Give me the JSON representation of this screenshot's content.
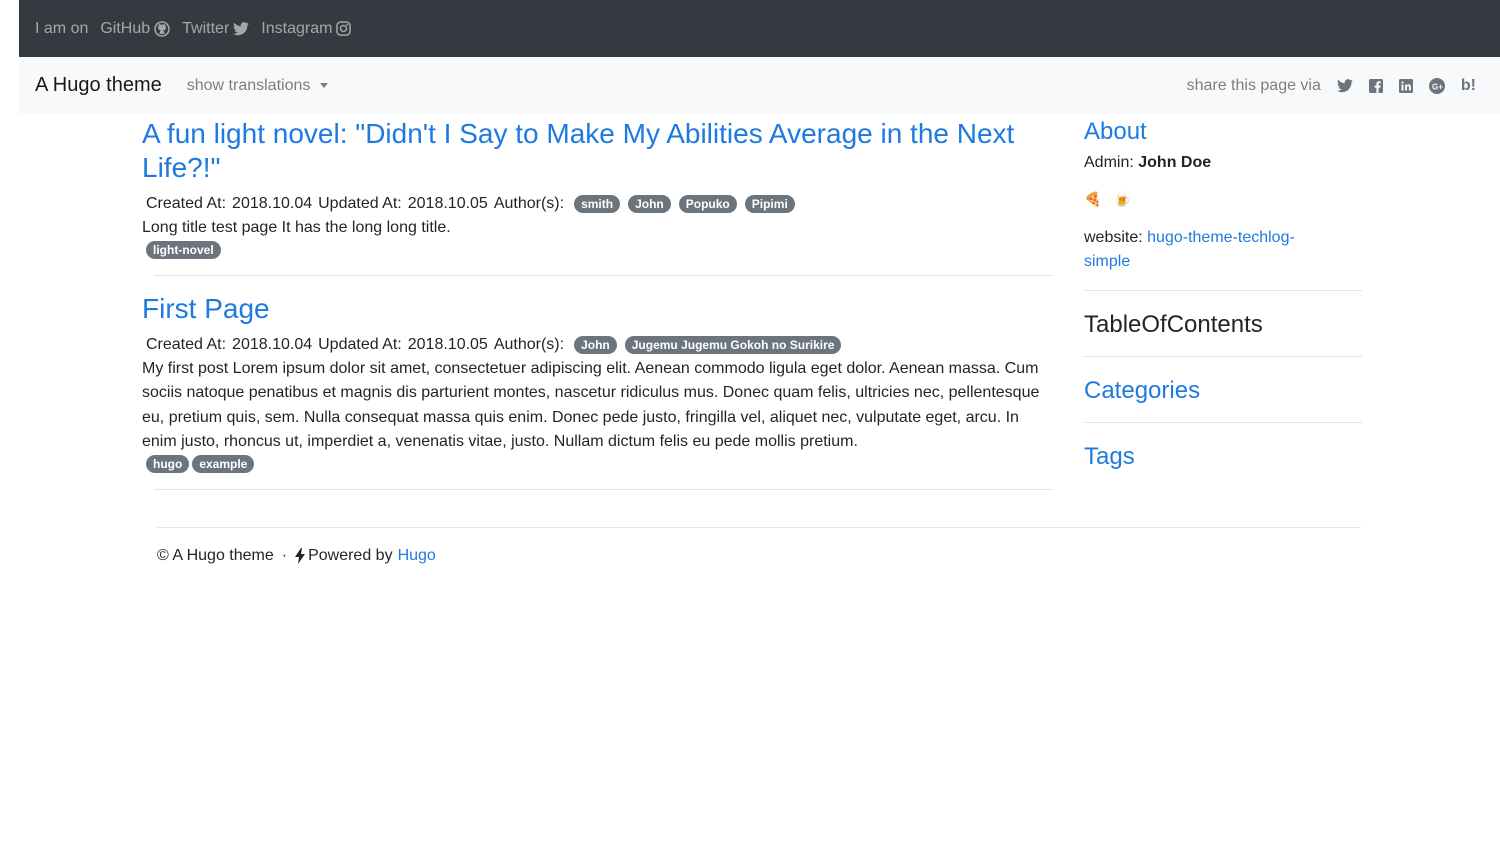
{
  "topbar": {
    "prefix": "I am on",
    "links": [
      {
        "label": "GitHub",
        "icon": "github-icon"
      },
      {
        "label": "Twitter",
        "icon": "twitter-icon"
      },
      {
        "label": "Instagram",
        "icon": "instagram-icon"
      }
    ]
  },
  "navbar": {
    "brand": "A Hugo theme",
    "translations": "show translations",
    "share_label": "share this page via",
    "share_icons": [
      "twitter-icon",
      "facebook-icon",
      "linkedin-icon",
      "google-plus-icon",
      "hatena-icon"
    ],
    "hatena_label": "b!"
  },
  "posts": [
    {
      "title": "A fun light novel: \"Didn't I Say to Make My Abilities Average in the Next Life?!\"",
      "created_label": "Created At:",
      "created": "2018.10.04",
      "updated_label": "Updated At:",
      "updated": "2018.10.05",
      "authors_label": "Author(s):",
      "authors": [
        "smith",
        "John",
        "Popuko",
        "Pipimi"
      ],
      "summary": "Long title test page It has the long long title.",
      "tags": [
        "light-novel"
      ]
    },
    {
      "title": "First Page",
      "created_label": "Created At:",
      "created": "2018.10.04",
      "updated_label": "Updated At:",
      "updated": "2018.10.05",
      "authors_label": "Author(s):",
      "authors": [
        "John",
        "Jugemu Jugemu Gokoh no Surikire"
      ],
      "summary": "My first post Lorem ipsum dolor sit amet, consectetuer adipiscing elit. Aenean commodo ligula eget dolor. Aenean massa. Cum sociis natoque penatibus et magnis dis parturient montes, nascetur ridiculus mus. Donec quam felis, ultricies nec, pellentesque eu, pretium quis, sem. Nulla consequat massa quis enim. Donec pede justo, fringilla vel, aliquet nec, vulputate eget, arcu. In enim justo, rhoncus ut, imperdiet a, venenatis vitae, justo. Nullam dictum felis eu pede mollis pretium.",
      "tags": [
        "hugo",
        "example"
      ]
    }
  ],
  "sidebar": {
    "about_title": "About",
    "admin_label": "Admin:",
    "admin_name": "John Doe",
    "emojis": [
      "🍕",
      "🍺"
    ],
    "website_label": "website:",
    "website_link": "hugo-theme-techlog-simple",
    "toc_title": "TableOfContents",
    "categories_title": "Categories",
    "tags_title": "Tags"
  },
  "footer": {
    "copyright": "© A Hugo theme",
    "separator": "·",
    "powered_by": "Powered by",
    "hugo_link": "Hugo"
  },
  "colors": {
    "topbar_bg": "#343a40",
    "navbar_bg": "#f8f9fa",
    "link": "#1f7ae0",
    "badge_bg": "#6c757d"
  }
}
